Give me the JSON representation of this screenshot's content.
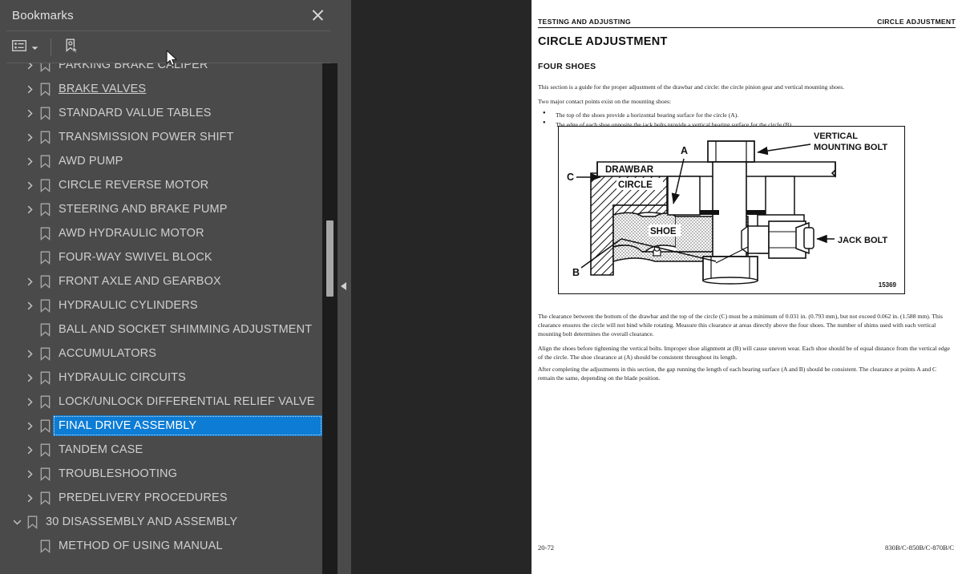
{
  "sidebar": {
    "title": "Bookmarks",
    "close_icon": "close-icon",
    "toolbar": {
      "options_label": "list-options-icon",
      "options_caret": "chevron-down-icon",
      "new_bookmark_label": "new-bookmark-icon"
    },
    "items": [
      {
        "label": "PARKING BRAKE CALIPER",
        "expandable": true,
        "level": 1,
        "state": "clipped"
      },
      {
        "label": "BRAKE VALVES",
        "expandable": true,
        "level": 1,
        "state": "hover"
      },
      {
        "label": "STANDARD VALUE TABLES",
        "expandable": true,
        "level": 1,
        "state": "normal"
      },
      {
        "label": "TRANSMISSION POWER SHIFT",
        "expandable": true,
        "level": 1,
        "state": "normal"
      },
      {
        "label": "AWD PUMP",
        "expandable": true,
        "level": 1,
        "state": "normal"
      },
      {
        "label": "CIRCLE REVERSE MOTOR",
        "expandable": true,
        "level": 1,
        "state": "normal"
      },
      {
        "label": "STEERING AND BRAKE PUMP",
        "expandable": true,
        "level": 1,
        "state": "normal"
      },
      {
        "label": "AWD HYDRAULIC MOTOR",
        "expandable": false,
        "level": 1,
        "state": "normal"
      },
      {
        "label": "FOUR-WAY SWIVEL BLOCK",
        "expandable": false,
        "level": 1,
        "state": "normal"
      },
      {
        "label": "FRONT AXLE AND GEARBOX",
        "expandable": true,
        "level": 1,
        "state": "normal"
      },
      {
        "label": "HYDRAULIC CYLINDERS",
        "expandable": true,
        "level": 1,
        "state": "normal"
      },
      {
        "label": "BALL AND SOCKET SHIMMING ADJUSTMENT",
        "expandable": false,
        "level": 1,
        "state": "normal"
      },
      {
        "label": "ACCUMULATORS",
        "expandable": true,
        "level": 1,
        "state": "normal"
      },
      {
        "label": "HYDRAULIC CIRCUITS",
        "expandable": true,
        "level": 1,
        "state": "normal"
      },
      {
        "label": "LOCK/UNLOCK DIFFERENTIAL RELIEF VALVE",
        "expandable": true,
        "level": 1,
        "state": "normal"
      },
      {
        "label": "FINAL DRIVE ASSEMBLY",
        "expandable": true,
        "level": 1,
        "state": "selected"
      },
      {
        "label": "TANDEM CASE",
        "expandable": true,
        "level": 1,
        "state": "normal"
      },
      {
        "label": "TROUBLESHOOTING",
        "expandable": true,
        "level": 1,
        "state": "normal"
      },
      {
        "label": "PREDELIVERY PROCEDURES",
        "expandable": true,
        "level": 1,
        "state": "normal"
      },
      {
        "label": "30 DISASSEMBLY AND ASSEMBLY",
        "expandable": true,
        "expanded": true,
        "level": 0,
        "state": "normal"
      },
      {
        "label": "METHOD OF USING MANUAL",
        "expandable": false,
        "level": 1,
        "state": "normal"
      }
    ],
    "collapse_panel_icon": "collapse-left-icon"
  },
  "document": {
    "running_head_left": "TESTING AND ADJUSTING",
    "running_head_right": "CIRCLE ADJUSTMENT",
    "heading": "CIRCLE ADJUSTMENT",
    "subheading": "FOUR SHOES",
    "paragraph_1": "This section is a guide for the proper adjustment of the drawbar and circle: the circle pinion gear and vertical mounting shoes.",
    "paragraph_2": "Two major contact points exist on the mounting shoes:",
    "bullets": [
      "The top of the shoes provide a horizontal bearing surface for the circle (A).",
      "The edge of each shoe opposite the jack bolts provide a vertical bearing surface for the circle (B)."
    ],
    "paragraph_3": "The clearance between the bottom of the drawbar and the top of the circle (C) must be a minimum of 0.031 in. (0.793 mm), but not exceed 0.062 in. (1.588 mm). This clearance ensures the circle will not bind while rotating. Measure this clearance at areas directly above the four shoes. The number of shims used with each vertical mounting bolt determines the overall clearance.",
    "paragraph_4": "Align the shoes before tightening the vertical bolts. Improper shoe alignment at (B) will cause uneven wear. Each shoe should be of equal distance from the vertical edge of the circle. The shoe clearance at (A) should be consistent throughout its length.",
    "paragraph_5": "After completing the adjustments in this section, the gap running the length of each bearing surface (A and B) should be consistent. The clearance at points A and C remain the same, depending on the blade position.",
    "figure": {
      "number": "15369",
      "labels": {
        "drawbar": "DRAWBAR",
        "circle": "CIRCLE",
        "shoe": "SHOE",
        "vertical_mounting_bolt": "VERTICAL\nMOUNTING BOLT",
        "vertical_mounting_bolt_line1": "VERTICAL",
        "vertical_mounting_bolt_line2": "MOUNTING BOLT",
        "jack_bolt": "JACK BOLT",
        "callout_a": "A",
        "callout_b": "B",
        "callout_c": "C"
      }
    },
    "footer_left": "20-72",
    "footer_right": "830B/C-850B/C-870B/C"
  },
  "colors": {
    "sidebar_bg": "#4a4a4a",
    "viewer_bg": "#262626",
    "selection_blue": "#0c7cd5",
    "page_bg": "#ffffff",
    "text_light": "#cfcfcf"
  }
}
